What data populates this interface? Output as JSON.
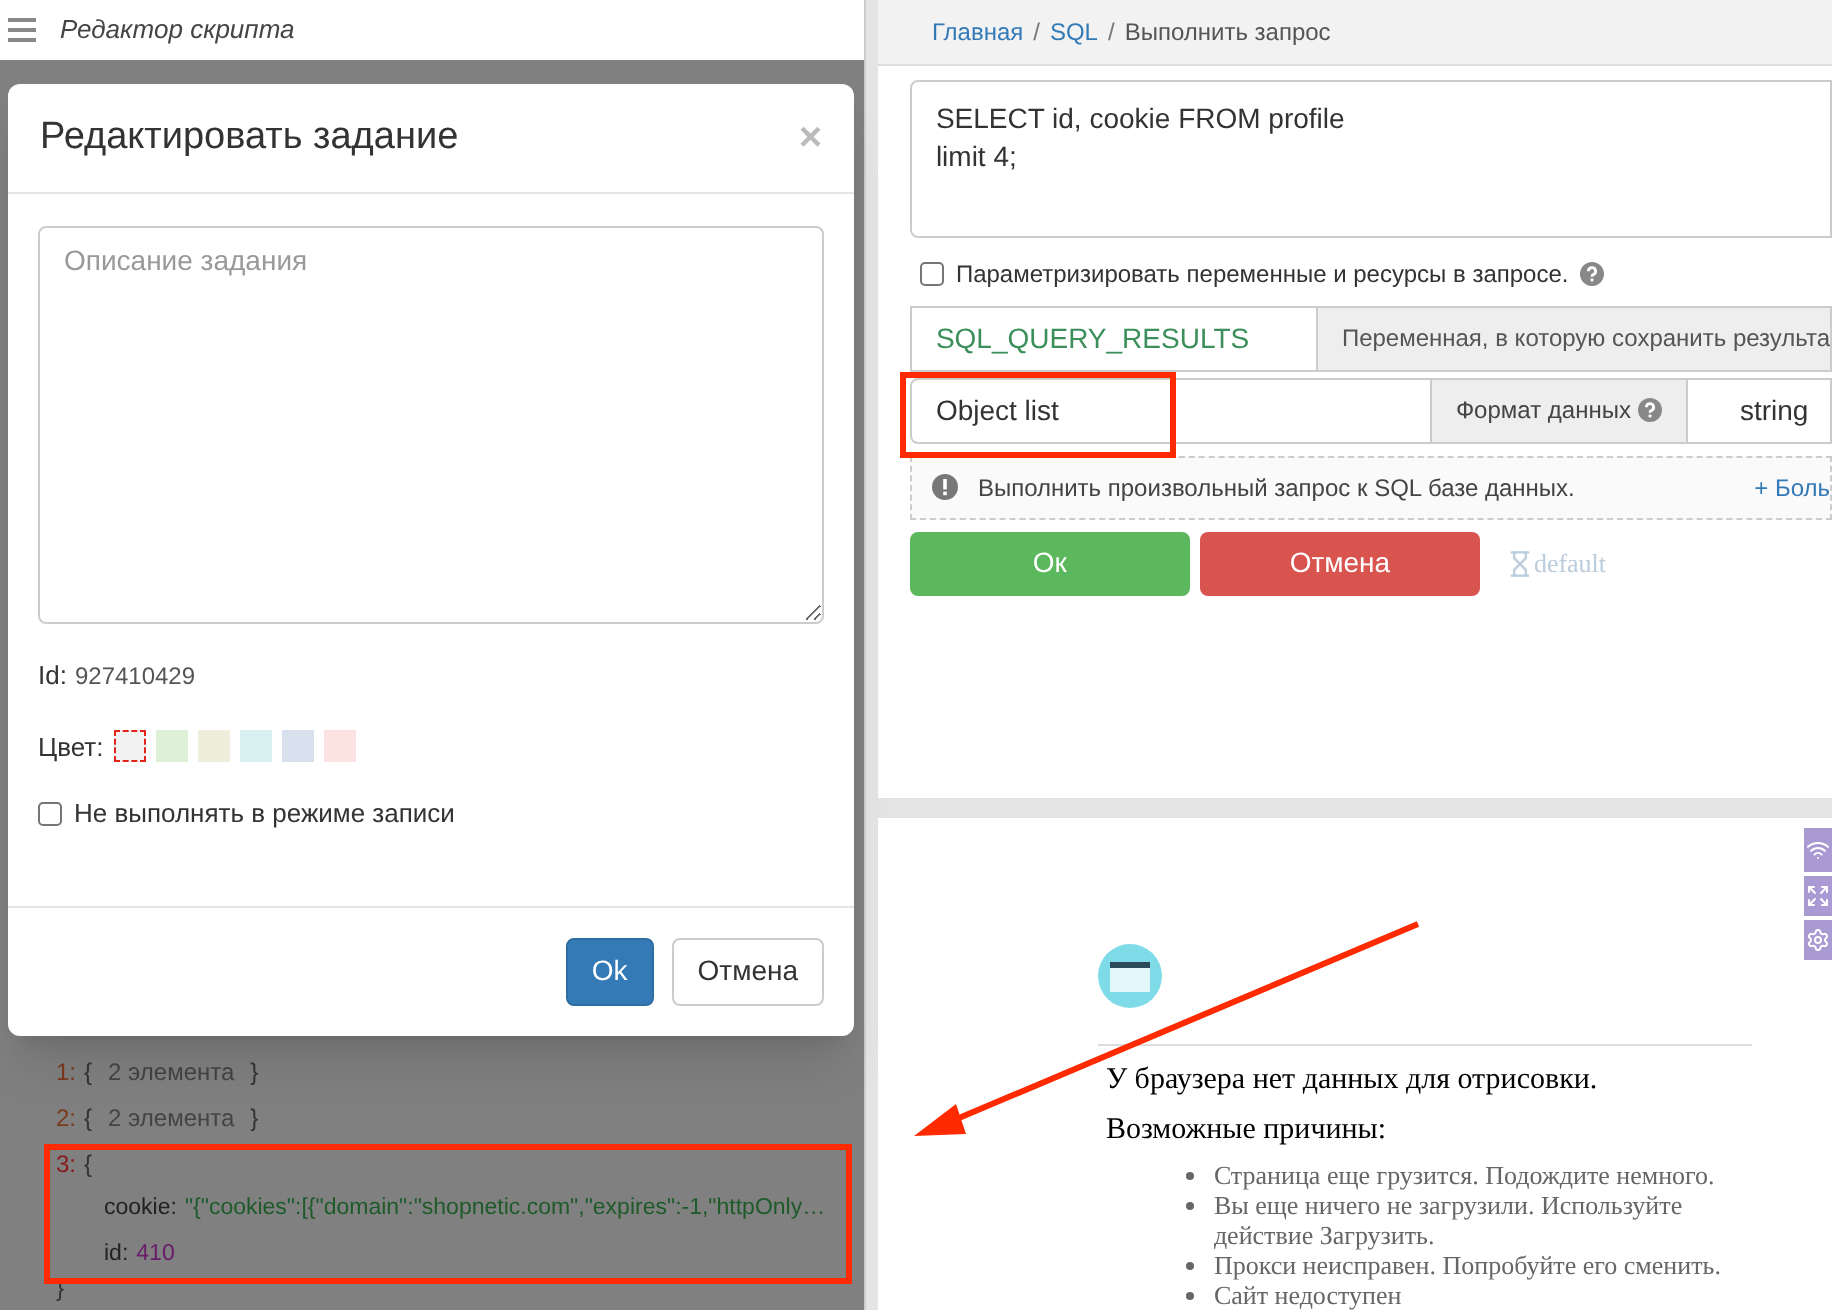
{
  "left_panel": {
    "title": "Редактор скрипта",
    "tree": [
      {
        "index": "1:",
        "open": "{",
        "summary": "2 элемента",
        "close": "}",
        "expanded": false
      },
      {
        "index": "2:",
        "open": "{",
        "summary": "2 элемента",
        "close": "}",
        "expanded": false
      },
      {
        "index": "3:",
        "open": "{",
        "expanded": true,
        "close": "}",
        "fields": [
          {
            "key": "cookie:",
            "value": "\"{\"cookies\":[{\"domain\":\"shopnetic.com\",\"expires\":-1,\"httpOnly…",
            "kind": "string"
          },
          {
            "key": "id:",
            "value": "410",
            "kind": "number"
          }
        ]
      }
    ]
  },
  "dialog": {
    "title": "Редактировать задание",
    "close": "×",
    "description_placeholder": "Описание задания",
    "id_label": "Id:",
    "id_value": "927410429",
    "color_label": "Цвет:",
    "colors": [
      {
        "color": "#f2f2f2",
        "selected": true
      },
      {
        "color": "#dff0d8",
        "selected": false
      },
      {
        "color": "#efeedb",
        "selected": false
      },
      {
        "color": "#d9f0f0",
        "selected": false
      },
      {
        "color": "#d9e1ef",
        "selected": false
      },
      {
        "color": "#fde2e2",
        "selected": false
      }
    ],
    "checkbox": {
      "label": "Не выполнять в режиме записи",
      "checked": false
    },
    "buttons": [
      {
        "label": "Ok",
        "kind": "primary"
      },
      {
        "label": "Отмена",
        "kind": "default"
      }
    ]
  },
  "right_panel": {
    "breadcrumb": [
      {
        "label": "Главная",
        "kind": "link"
      },
      {
        "label": "/",
        "kind": "separator"
      },
      {
        "label": "SQL",
        "kind": "link"
      },
      {
        "label": "/",
        "kind": "separator"
      },
      {
        "label": "Выполнить запрос",
        "kind": "current"
      }
    ],
    "query": "SELECT id, cookie FROM profile\nlimit 4;",
    "parametrize": {
      "label": "Параметризировать переменные и ресурсы в запросе.",
      "checked": false
    },
    "variable": {
      "value": "SQL_QUERY_RESULTS",
      "hint": "Переменная, в которую сохранить результа"
    },
    "format": {
      "value": "Object list",
      "label": "Формат данных",
      "type": "string"
    },
    "info": {
      "text": "Выполнить произвольный запрос к SQL базе данных.",
      "more": "+ Боль"
    },
    "buttons": [
      {
        "label": "Ок",
        "kind": "success"
      },
      {
        "label": "Отмена",
        "kind": "danger"
      }
    ],
    "timer": "default"
  },
  "browser": {
    "heading": "У браузера нет данных для отрисовки.",
    "subheading": "Возможные причины:",
    "reasons": [
      "Страница еще грузится. Подождите немного.",
      "Вы еще ничего не загрузили. Используйте действие Загрузить.",
      "Прокси неисправен. Попробуйте его сменить.",
      "Сайт недоступен"
    ]
  }
}
